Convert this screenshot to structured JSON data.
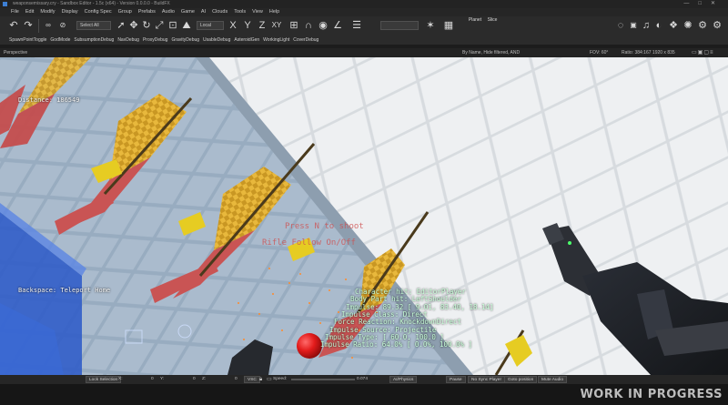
{
  "window": {
    "title": "weaponsemissary.cry - Sandbox Editor - 1.5c (x64) - Version 0.0.0.0 - BuildFX",
    "controls": [
      "—",
      "□",
      "✕"
    ]
  },
  "menu": {
    "items": [
      "File",
      "Edit",
      "Modify",
      "Display",
      "Config Spec",
      "Group",
      "Prefabs",
      "Audio",
      "Game",
      "AI",
      "Clouds",
      "Tools",
      "View",
      "Help"
    ]
  },
  "toolbar": {
    "select_mode": "Select All",
    "coord_system": "Local",
    "axis_labels": [
      "X",
      "Y",
      "Z",
      "XY"
    ],
    "planet_label": "Planet",
    "slice_label": "Slice",
    "icons": [
      "undo-icon",
      "redo-icon",
      "link-icon",
      "unlink-icon",
      "select-icon",
      "move-icon",
      "rotate-icon",
      "scale-icon",
      "snap-icon",
      "terrain-icon",
      "grid-icon",
      "magnet-icon",
      "camera-icon",
      "settings-icon"
    ]
  },
  "debug_toolbar": {
    "items": [
      "SpawnPointToggle",
      "GodMode",
      "SubsumptionDebug",
      "NavDebug",
      "ProxyDebug",
      "GravityDebug",
      "UsableDebug",
      "AsteroidGen",
      "WorkingLight",
      "CoverDebug"
    ]
  },
  "viewport_bar": {
    "title": "Perspective",
    "filter": "By Name, Hide filtered, AND",
    "fov": "FOV:    60°",
    "ratio": "Ratio:  384:167    1920 x 835"
  },
  "hud": {
    "distance": "Distance: 186549",
    "teleport": "Backspace: Teleport Home",
    "shoot_hint": "Press N to shoot",
    "follow_hint": "Rifle Follow On/Off",
    "hit_info": [
      "Character hit: EditorPlayer",
      "Body Part hit: LeftShoulder",
      "Impulse: 89.32 [ 9.01, 83.40, 18.14]",
      "Impulse Class: Direct",
      "Force Reaction: KnockdownDirect",
      "Impulse Source: Projectile",
      "Impulse Type: [ 60.0, 100.0 ]",
      "Impulse Ratio: 64.0% [ 0.0%, 100.0% ]"
    ]
  },
  "statusbar": {
    "lock_selection": "Lock Selection",
    "x_label": "X:",
    "x_value": "0",
    "y_label": "Y:",
    "y_value": "0",
    "z_label": "Z:",
    "z_value": "0",
    "vsc": "VSC",
    "speed_label": "Speed:",
    "speed_value": "0.074",
    "ai_physics": "AI/Physics",
    "pause": "Pause",
    "no_sync_player": "No Sync Player",
    "goto_position": "Goto position",
    "mute_audio": "Mute Audio"
  },
  "overlay": {
    "watermark": "WORK IN PROGRESS"
  },
  "colors": {
    "editor_bg": "#2b2b2b",
    "hud_green": "#c8ffd8",
    "hud_red": "#cf4f4f",
    "target_yellow": "#e7c23a",
    "target_red": "#d14a4a",
    "wall_tile": "#e8e8e8",
    "floor_tile": "#8ea3b8",
    "ball_red": "#e31b1b"
  }
}
